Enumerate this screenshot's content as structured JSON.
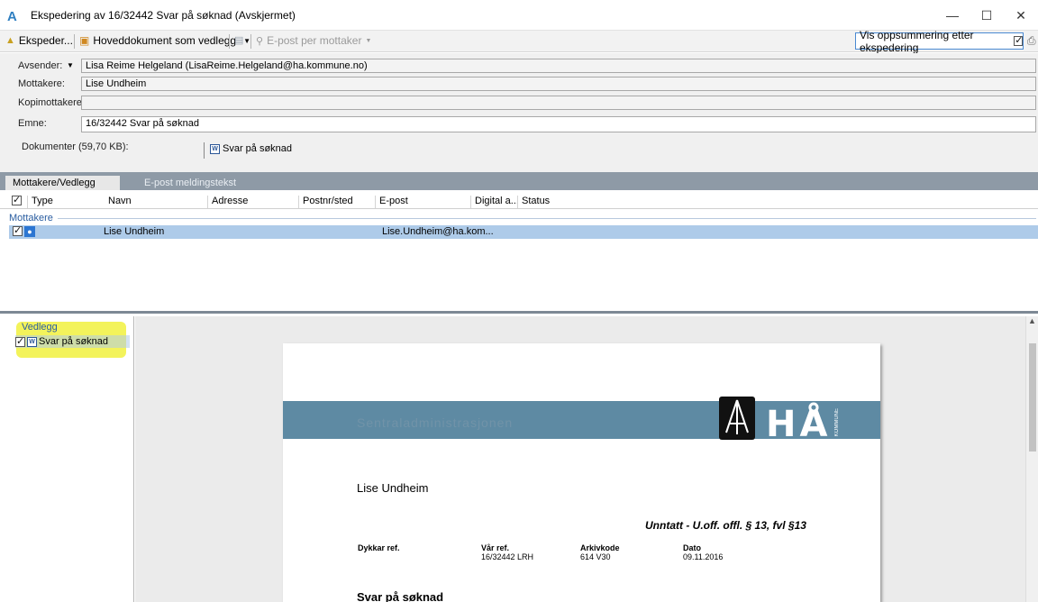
{
  "window": {
    "title": "Ekspedering av 16/32442 Svar på søknad (Avskjermet)",
    "minimize": "—",
    "maximize": "☐",
    "close": "✕"
  },
  "toolbar": {
    "ekspeder_label": "Ekspeder...",
    "hoveddokument_label": "Hoveddokument som vedlegg",
    "epost_per_mottaker_label": "E-post per mottaker",
    "vis_oppsummering_label": "Vis oppsummering etter ekspedering",
    "vis_oppsummering_checked": true
  },
  "header": {
    "avsender_label": "Avsender:",
    "avsender_value": "Lisa Reime Helgeland (LisaReime.Helgeland@ha.kommune.no)",
    "mottakere_label": "Mottakere:",
    "mottakere_value": "Lise Undheim",
    "kopimottakere_label": "Kopimottakere:",
    "kopimottakere_value": "",
    "emne_label": "Emne:",
    "emne_value": "16/32442 Svar på søknad",
    "dokumenter_label": "Dokumenter (59,70 KB):",
    "dokument_name": "Svar på søknad"
  },
  "tabs": [
    {
      "label": "Mottakere/Vedlegg",
      "active": true
    },
    {
      "label": "E-post meldingstekst",
      "active": false
    }
  ],
  "grid": {
    "columns": [
      "Type",
      "Navn",
      "Adresse",
      "Postnr/sted",
      "E-post",
      "Digital a...",
      "Status"
    ],
    "group_label": "Mottakere",
    "rows": [
      {
        "checked": true,
        "navn": "Lise Undheim",
        "adresse": "",
        "postnr": "",
        "epost": "Lise.Undheim@ha.kom...",
        "digital": "",
        "status": ""
      }
    ]
  },
  "vedlegg": {
    "label": "Vedlegg",
    "items": [
      {
        "name": "Svar på søknad",
        "checked": true
      }
    ]
  },
  "preview": {
    "band_text": "Sentraladministrasjonen",
    "logo_text": "HÅ",
    "logo_sub": "KOMMUNE",
    "recipient": "Lise Undheim",
    "unntatt": "Unntatt - U.off. offl. § 13, fvl §13",
    "refs": [
      {
        "label": "Dykkar ref.",
        "value": ""
      },
      {
        "label": "Vår ref.",
        "value": "16/32442 LRH"
      },
      {
        "label": "Arkivkode",
        "value": "614 V30"
      },
      {
        "label": "Dato",
        "value": "09.11.2016"
      }
    ],
    "subject": "Svar på søknad"
  },
  "colors": {
    "band": "#5e8aa3",
    "selection": "#aecbe9",
    "highlight": "#f3f35b",
    "tabbar": "#8e9aa6"
  }
}
